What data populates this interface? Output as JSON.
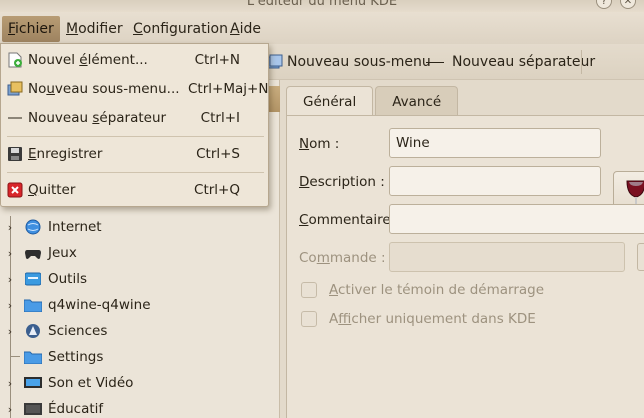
{
  "window": {
    "title": "L'éditeur du menu KDE"
  },
  "menubar": {
    "items": [
      {
        "pre": "",
        "u": "F",
        "post": "ichier"
      },
      {
        "pre": "",
        "u": "M",
        "post": "odifier"
      },
      {
        "pre": "",
        "u": "C",
        "post": "onfiguration"
      },
      {
        "pre": "",
        "u": "A",
        "post": "ide"
      }
    ]
  },
  "file_menu": {
    "items": [
      {
        "pre": "Nouvel ",
        "u": "é",
        "post": "lément...",
        "shortcut": "Ctrl+N",
        "icon": "new-item-icon"
      },
      {
        "pre": "No",
        "u": "u",
        "post": "veau sous-menu...",
        "shortcut": "Ctrl+Maj+N",
        "icon": "new-submenu-icon"
      },
      {
        "pre": "Nouveau ",
        "u": "s",
        "post": "éparateur",
        "shortcut": "Ctrl+I",
        "icon": "separator-line-icon"
      },
      {
        "pre": "",
        "u": "E",
        "post": "nregistrer",
        "shortcut": "Ctrl+S",
        "icon": "save-icon"
      },
      {
        "pre": "",
        "u": "Q",
        "post": "uitter",
        "shortcut": "Ctrl+Q",
        "icon": "quit-icon"
      }
    ]
  },
  "toolbar": {
    "new_submenu": "Nouveau sous-menu",
    "new_separator": "Nouveau séparateur"
  },
  "tree": {
    "items": [
      {
        "label": "Internet",
        "icon": "globe-icon"
      },
      {
        "label": "Jeux",
        "icon": "gamepad-icon"
      },
      {
        "label": "Outils",
        "icon": "tools-icon"
      },
      {
        "label": "q4wine-q4wine",
        "icon": "folder-icon"
      },
      {
        "label": "Sciences",
        "icon": "science-icon"
      },
      {
        "label": "Settings",
        "icon": "folder-icon"
      },
      {
        "label": "Son et Vidéo",
        "icon": "multimedia-icon"
      },
      {
        "label": "Éducatif",
        "icon": "education-icon"
      }
    ]
  },
  "tabs": [
    {
      "label": "Général"
    },
    {
      "label": "Avancé"
    }
  ],
  "form": {
    "name": {
      "pre": "",
      "u": "N",
      "post": "om :",
      "value": "Wine"
    },
    "description": {
      "pre": "",
      "u": "D",
      "post": "escription :",
      "value": ""
    },
    "comment": {
      "pre": "",
      "u": "C",
      "post": "ommentaire :",
      "value": ""
    },
    "command": {
      "pre": "Co",
      "u": "m",
      "post": "mande :",
      "value": ""
    },
    "startup_feedback": {
      "pre": "",
      "u": "A",
      "post": "ctiver le témoin de démarrage"
    },
    "kde_only": {
      "pre": "A",
      "u": "f",
      "post": "ficher uniquement dans KDE"
    }
  },
  "colors": {
    "menu_highlight": "#a98c65",
    "accent_button": "#b99d70",
    "wine_red": "#7a1020"
  }
}
